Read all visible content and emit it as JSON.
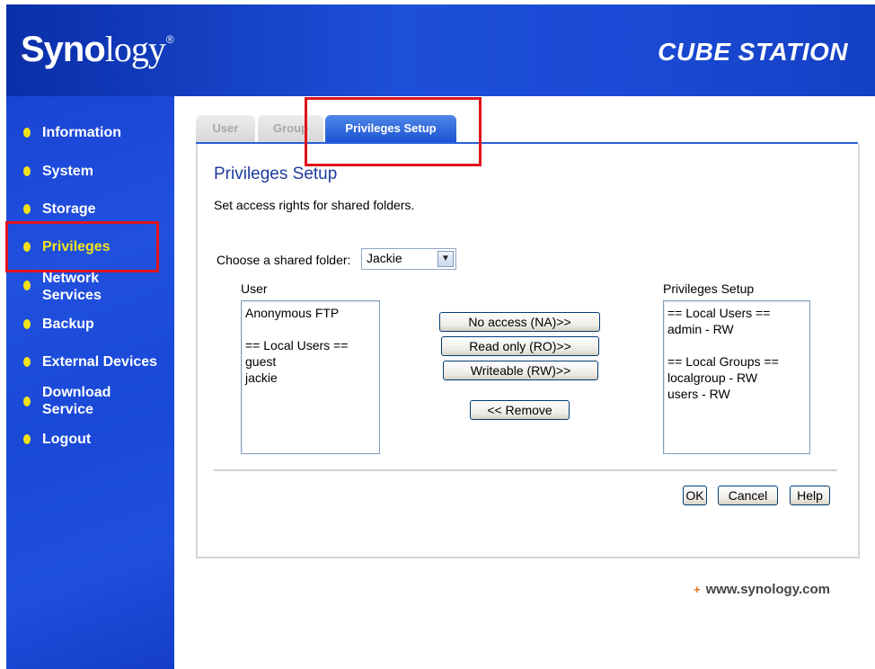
{
  "header": {
    "logo_bold": "Syno",
    "logo_rest": "logy",
    "logo_mark": "®",
    "product": "CUBE STATION"
  },
  "sidebar": {
    "items": [
      {
        "label": "Information",
        "active": false
      },
      {
        "label": "System",
        "active": false
      },
      {
        "label": "Storage",
        "active": false
      },
      {
        "label": "Privileges",
        "active": true
      },
      {
        "label": "Network Services",
        "active": false
      },
      {
        "label": "Backup",
        "active": false
      },
      {
        "label": "External Devices",
        "active": false
      },
      {
        "label": "Download Service",
        "active": false
      },
      {
        "label": "Logout",
        "active": false
      }
    ]
  },
  "tabs": [
    {
      "label": "User",
      "active": false
    },
    {
      "label": "Group",
      "active": false
    },
    {
      "label": "Privileges Setup",
      "active": true
    }
  ],
  "panel": {
    "title": "Privileges Setup",
    "description": "Set access rights for shared folders.",
    "choose_label": "Choose a shared folder:",
    "selected_folder": "Jackie",
    "user_list_label": "User",
    "user_list": [
      "Anonymous FTP",
      "",
      "== Local Users ==",
      "guest",
      "jackie"
    ],
    "privileges_list_label": "Privileges Setup",
    "privileges_list": [
      "== Local Users ==",
      "admin - RW",
      "",
      "== Local Groups ==",
      "localgroup - RW",
      "users - RW"
    ],
    "buttons": {
      "no_access": "No access (NA)>>",
      "read_only": "Read only (RO)>>",
      "writeable": "Writeable (RW)>>",
      "remove": "<< Remove",
      "ok": "OK",
      "cancel": "Cancel",
      "help": "Help"
    }
  },
  "footer": {
    "url": "www.synology.com"
  },
  "colors": {
    "header_blue": "#1e4fd8",
    "active_nav": "#f4e41a",
    "highlight_red": "#e0141c",
    "title_blue": "#1f3c9c"
  }
}
